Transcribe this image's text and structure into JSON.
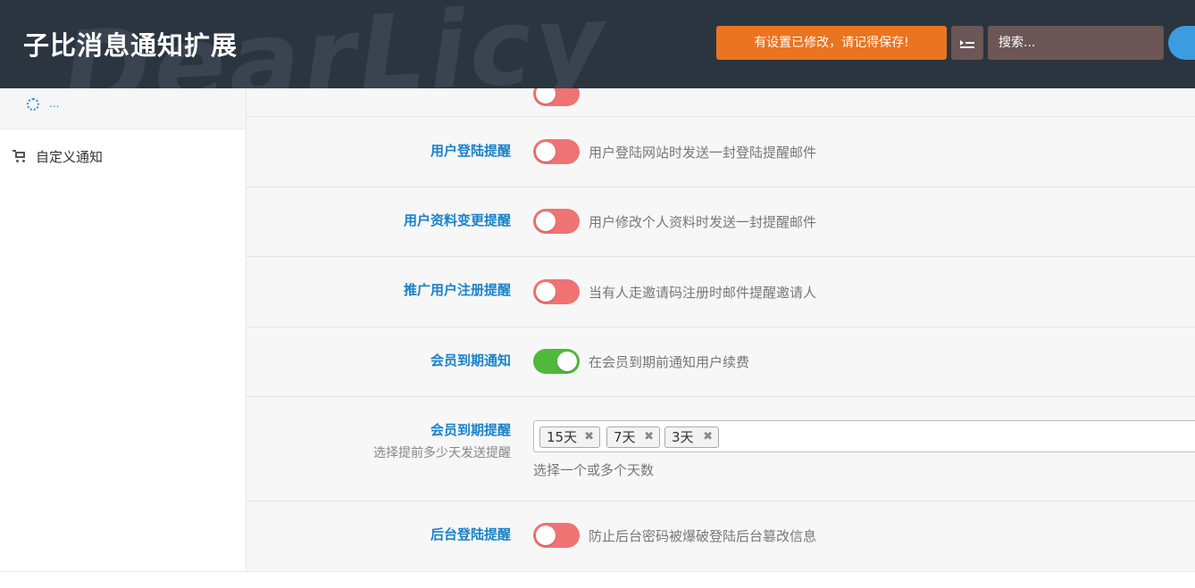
{
  "header": {
    "title": "子比消息通知扩展",
    "watermark": "DearLicy",
    "save_notice": "有设置已修改，请记得保存!",
    "search_placeholder": "搜索..."
  },
  "sidebar": {
    "loading_text": "...",
    "items": [
      {
        "label": "自定义通知",
        "icon": "cart-icon"
      }
    ]
  },
  "settings": [
    {
      "label": "用户登陆提醒",
      "desc": "用户登陆网站时发送一封登陆提醒邮件",
      "enabled": false
    },
    {
      "label": "用户资料变更提醒",
      "desc": "用户修改个人资料时发送一封提醒邮件",
      "enabled": false
    },
    {
      "label": "推广用户注册提醒",
      "desc": "当有人走邀请码注册时邮件提醒邀请人",
      "enabled": false
    },
    {
      "label": "会员到期通知",
      "desc": "在会员到期前通知用户续费",
      "enabled": true
    },
    {
      "label": "会员到期提醒",
      "sublabel": "选择提前多少天发送提醒",
      "tags": [
        "15天",
        "7天",
        "3天"
      ],
      "hint": "选择一个或多个天数"
    },
    {
      "label": "后台登陆提醒",
      "desc": "防止后台密码被爆破登陆后台篡改信息",
      "enabled": false
    }
  ],
  "colors": {
    "header_bg": "#2b3540",
    "accent_blue": "#1a82c9",
    "notice_orange": "#ea7420",
    "switch_off": "#f07373",
    "switch_on": "#50b83c"
  }
}
